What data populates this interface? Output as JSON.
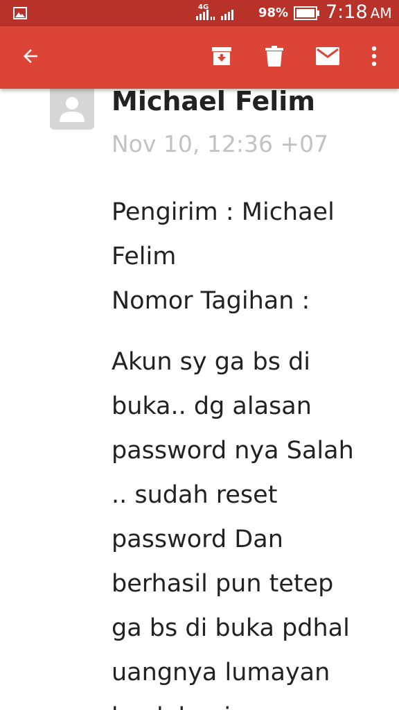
{
  "status_bar": {
    "network": "4G",
    "battery_percent": "98%",
    "time": "7:18",
    "ampm": "AM"
  },
  "toolbar": {
    "icons": [
      "back-arrow-icon",
      "archive-icon",
      "delete-icon",
      "mark-unread-icon",
      "more-vert-icon"
    ]
  },
  "email": {
    "sender": "Michael Felim",
    "date": "Nov 10, 12:36 +07",
    "header_lines": [
      "Pengirim : Michael",
      "Felim",
      "Nomor Tagihan :"
    ],
    "message_lines": [
      "Akun sy ga bs di",
      "buka.. dg alasan",
      "password nya Salah",
      ".. sudah reset",
      "password Dan",
      "berhasil pun tetep",
      "ga bs di buka pdhal",
      "uangnya lumayan",
      "bnyk bagi sy"
    ]
  },
  "colors": {
    "status_bar": "#b8322a",
    "app_bar": "#db4437",
    "text": "#222222",
    "muted": "#c2c2c2"
  }
}
